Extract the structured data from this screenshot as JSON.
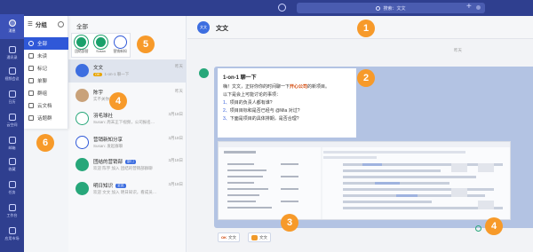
{
  "rail": {
    "items": [
      {
        "label": "消息",
        "icon": "chat-icon"
      },
      {
        "label": "通讯录",
        "icon": "contacts-icon"
      },
      {
        "label": "视频会议",
        "icon": "video-icon"
      },
      {
        "label": "日历",
        "icon": "calendar-icon"
      },
      {
        "label": "云空间",
        "icon": "cloud-icon"
      },
      {
        "label": "邮箱",
        "icon": "mail-icon"
      },
      {
        "label": "收藏",
        "icon": "star-icon"
      },
      {
        "label": "任务",
        "icon": "task-icon"
      },
      {
        "label": "工作台",
        "icon": "workbench-icon"
      },
      {
        "label": "应用市场",
        "icon": "apps-icon"
      }
    ]
  },
  "topbar": {
    "search_text": "搜索：文文"
  },
  "menu": {
    "title": "分组",
    "items": [
      {
        "label": "全部"
      },
      {
        "label": "未读"
      },
      {
        "label": "标记"
      },
      {
        "label": "单聊"
      },
      {
        "label": "群组"
      },
      {
        "label": "云文档"
      },
      {
        "label": "话题群"
      }
    ]
  },
  "list": {
    "title": "全部",
    "quick_access": [
      {
        "label": "团结部营"
      },
      {
        "label": "Susan"
      },
      {
        "label": "营销新知"
      }
    ],
    "rows": [
      {
        "name": "文文",
        "preview": "1-on-1 聊一下",
        "time": "昨天",
        "tag": "OK",
        "avatar_text": "文文"
      },
      {
        "name": "陈宇",
        "preview": "实不关你事情 …",
        "time": "昨天"
      },
      {
        "name": "羽毛球社",
        "preview": "Susan: 周末正下视频，公司报名…",
        "time": "3月18日"
      },
      {
        "name": "营销新知分享",
        "preview": "Susan: 发起群聊",
        "time": "3月18日"
      },
      {
        "name": "团结的营销部",
        "preview": "欢迎 陈宇 加入 团结的营销部群聊",
        "time": "3月18日",
        "tag": "部门"
      },
      {
        "name": "明日知识",
        "preview": "欢迎 文文 加入 明日知识，看成员…",
        "time": "3月18日",
        "tag": "全员"
      }
    ]
  },
  "chat": {
    "title": "文文",
    "avatar_text": "文文",
    "date": "昨天",
    "message": {
      "title": "1-on-1 聊一下",
      "line1": "嗨！文文，正好你你的时间聊一下",
      "line1_hl": "开心公司",
      "line1_end": "的新项目。",
      "line2": "以下是会上可能讨论的事项：",
      "items": [
        {
          "num": "1、",
          "text": "项目的负责人都有谁?"
        },
        {
          "num": "2、",
          "text": "项目目标和是否已经与 @Mia 对过?"
        },
        {
          "num": "3、",
          "text": "下面是项目的具体排期，是否合理?"
        }
      ]
    },
    "reactions": [
      {
        "emoji": "OK",
        "user": "文文"
      },
      {
        "emoji": "",
        "user": "文文"
      }
    ]
  },
  "callouts": [
    "1",
    "2",
    "3",
    "4",
    "4",
    "5",
    "6"
  ],
  "colors": {
    "rail": "#2f3f8f",
    "accent": "#2f58d8",
    "callout": "#f79a2a",
    "bubble": "#b3c3e3",
    "tag": "#e7a300"
  }
}
